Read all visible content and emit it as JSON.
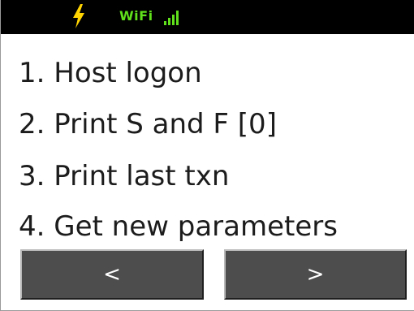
{
  "status_bar": {
    "power_icon": "lightning-bolt-icon",
    "wifi_label": "WiFi",
    "signal_icon": "signal-bars-icon",
    "accent_color": "#5fe01a",
    "bolt_color": "#ffd400",
    "background": "#000000"
  },
  "menu": {
    "items": [
      {
        "label": "1. Host logon"
      },
      {
        "label": "2. Print S and F [0]"
      },
      {
        "label": "3. Print last txn"
      },
      {
        "label": "4. Get new parameters"
      }
    ]
  },
  "navigation": {
    "prev_label": "<",
    "next_label": ">",
    "button_color": "#4d4d4d"
  }
}
